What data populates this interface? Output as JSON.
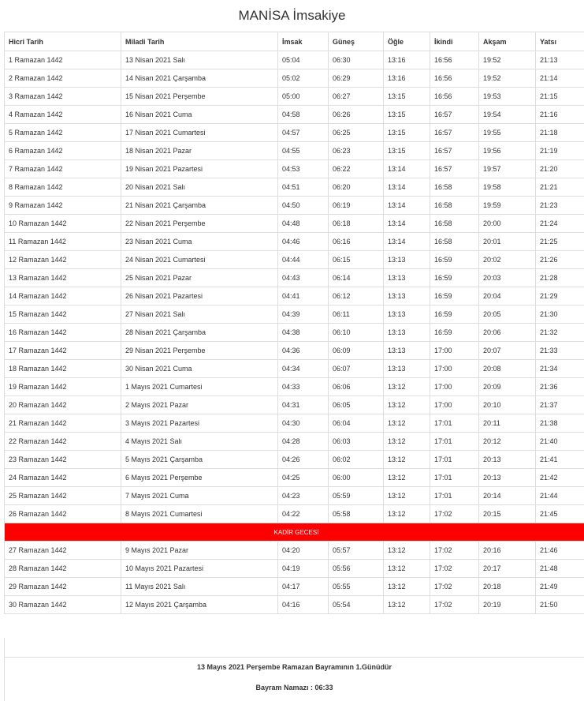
{
  "page": {
    "title": "MANİSA İmsakiye"
  },
  "table": {
    "columns": [
      "Hicri Tarih",
      "Miladi Tarih",
      "İmsak",
      "Güneş",
      "Öğle",
      "İkindi",
      "Akşam",
      "Yatsı"
    ],
    "rows": [
      [
        "1 Ramazan 1442",
        "13 Nisan 2021 Salı",
        "05:04",
        "06:30",
        "13:16",
        "16:56",
        "19:52",
        "21:13"
      ],
      [
        "2 Ramazan 1442",
        "14 Nisan 2021 Çarşamba",
        "05:02",
        "06:29",
        "13:16",
        "16:56",
        "19:52",
        "21:14"
      ],
      [
        "3 Ramazan 1442",
        "15 Nisan 2021 Perşembe",
        "05:00",
        "06:27",
        "13:15",
        "16:56",
        "19:53",
        "21:15"
      ],
      [
        "4 Ramazan 1442",
        "16 Nisan 2021 Cuma",
        "04:58",
        "06:26",
        "13:15",
        "16:57",
        "19:54",
        "21:16"
      ],
      [
        "5 Ramazan 1442",
        "17 Nisan 2021 Cumartesi",
        "04:57",
        "06:25",
        "13:15",
        "16:57",
        "19:55",
        "21:18"
      ],
      [
        "6 Ramazan 1442",
        "18 Nisan 2021 Pazar",
        "04:55",
        "06:23",
        "13:15",
        "16:57",
        "19:56",
        "21:19"
      ],
      [
        "7 Ramazan 1442",
        "19 Nisan 2021 Pazartesi",
        "04:53",
        "06:22",
        "13:14",
        "16:57",
        "19:57",
        "21:20"
      ],
      [
        "8 Ramazan 1442",
        "20 Nisan 2021 Salı",
        "04:51",
        "06:20",
        "13:14",
        "16:58",
        "19:58",
        "21:21"
      ],
      [
        "9 Ramazan 1442",
        "21 Nisan 2021 Çarşamba",
        "04:50",
        "06:19",
        "13:14",
        "16:58",
        "19:59",
        "21:23"
      ],
      [
        "10 Ramazan 1442",
        "22 Nisan 2021 Perşembe",
        "04:48",
        "06:18",
        "13:14",
        "16:58",
        "20:00",
        "21:24"
      ],
      [
        "11 Ramazan 1442",
        "23 Nisan 2021 Cuma",
        "04:46",
        "06:16",
        "13:14",
        "16:58",
        "20:01",
        "21:25"
      ],
      [
        "12 Ramazan 1442",
        "24 Nisan 2021 Cumartesi",
        "04:44",
        "06:15",
        "13:13",
        "16:59",
        "20:02",
        "21:26"
      ],
      [
        "13 Ramazan 1442",
        "25 Nisan 2021 Pazar",
        "04:43",
        "06:14",
        "13:13",
        "16:59",
        "20:03",
        "21:28"
      ],
      [
        "14 Ramazan 1442",
        "26 Nisan 2021 Pazartesi",
        "04:41",
        "06:12",
        "13:13",
        "16:59",
        "20:04",
        "21:29"
      ],
      [
        "15 Ramazan 1442",
        "27 Nisan 2021 Salı",
        "04:39",
        "06:11",
        "13:13",
        "16:59",
        "20:05",
        "21:30"
      ],
      [
        "16 Ramazan 1442",
        "28 Nisan 2021 Çarşamba",
        "04:38",
        "06:10",
        "13:13",
        "16:59",
        "20:06",
        "21:32"
      ],
      [
        "17 Ramazan 1442",
        "29 Nisan 2021 Perşembe",
        "04:36",
        "06:09",
        "13:13",
        "17:00",
        "20:07",
        "21:33"
      ],
      [
        "18 Ramazan 1442",
        "30 Nisan 2021 Cuma",
        "04:34",
        "06:07",
        "13:13",
        "17:00",
        "20:08",
        "21:34"
      ],
      [
        "19 Ramazan 1442",
        "1 Mayıs 2021 Cumartesi",
        "04:33",
        "06:06",
        "13:12",
        "17:00",
        "20:09",
        "21:36"
      ],
      [
        "20 Ramazan 1442",
        "2 Mayıs 2021 Pazar",
        "04:31",
        "06:05",
        "13:12",
        "17:00",
        "20:10",
        "21:37"
      ],
      [
        "21 Ramazan 1442",
        "3 Mayıs 2021 Pazartesi",
        "04:30",
        "06:04",
        "13:12",
        "17:01",
        "20:11",
        "21:38"
      ],
      [
        "22 Ramazan 1442",
        "4 Mayıs 2021 Salı",
        "04:28",
        "06:03",
        "13:12",
        "17:01",
        "20:12",
        "21:40"
      ],
      [
        "23 Ramazan 1442",
        "5 Mayıs 2021 Çarşamba",
        "04:26",
        "06:02",
        "13:12",
        "17:01",
        "20:13",
        "21:41"
      ],
      [
        "24 Ramazan 1442",
        "6 Mayıs 2021 Perşembe",
        "04:25",
        "06:00",
        "13:12",
        "17:01",
        "20:13",
        "21:42"
      ],
      [
        "25 Ramazan 1442",
        "7 Mayıs 2021 Cuma",
        "04:23",
        "05:59",
        "13:12",
        "17:01",
        "20:14",
        "21:44"
      ],
      [
        "26 Ramazan 1442",
        "8 Mayıs 2021 Cumartesi",
        "04:22",
        "05:58",
        "13:12",
        "17:02",
        "20:15",
        "21:45"
      ],
      {
        "special": "KADİR GECESİ"
      },
      [
        "27 Ramazan 1442",
        "9 Mayıs 2021 Pazar",
        "04:20",
        "05:57",
        "13:12",
        "17:02",
        "20:16",
        "21:46"
      ],
      [
        "28 Ramazan 1442",
        "10 Mayıs 2021 Pazartesi",
        "04:19",
        "05:56",
        "13:12",
        "17:02",
        "20:17",
        "21:48"
      ],
      [
        "29 Ramazan 1442",
        "11 Mayıs 2021 Salı",
        "04:17",
        "05:55",
        "13:12",
        "17:02",
        "20:18",
        "21:49"
      ],
      [
        "30 Ramazan 1442",
        "12 Mayıs 2021 Çarşamba",
        "04:16",
        "05:54",
        "13:12",
        "17:02",
        "20:19",
        "21:50"
      ]
    ]
  },
  "footer": {
    "bayram_text": "13 Mayıs 2021 Perşembe Ramazan Bayramının 1.Günüdür",
    "namaz_text": "Bayram Namazı : 06:33"
  },
  "colors": {
    "highlight": "#ff0000",
    "border": "#dddddd",
    "text": "#333333"
  }
}
